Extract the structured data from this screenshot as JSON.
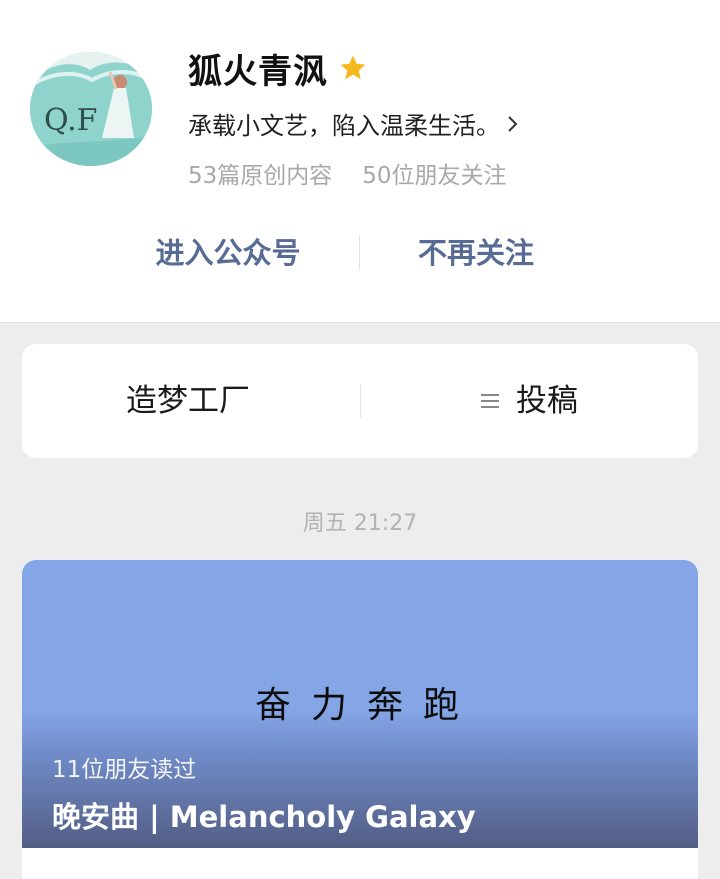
{
  "profile": {
    "name": "狐火青沨",
    "description": "承载小文艺，陷入温柔生活。",
    "avatar_text": "Q.F",
    "stats": {
      "articles": "53篇原创内容",
      "followers": "50位朋友关注"
    },
    "star_icon": "star-icon",
    "colors": {
      "star": "#f5b91e",
      "link": "#576b95"
    }
  },
  "actions": {
    "enter": "进入公众号",
    "unfollow": "不再关注"
  },
  "menu": {
    "items": [
      {
        "label": "造梦工厂"
      },
      {
        "label": "投稿",
        "icon": "menu-lines-icon"
      }
    ]
  },
  "feed": {
    "time": "周五 21:27",
    "article": {
      "cover_text": "奋力奔跑",
      "readers": "11位朋友读过",
      "title": "晚安曲 | Melancholy Galaxy"
    }
  }
}
